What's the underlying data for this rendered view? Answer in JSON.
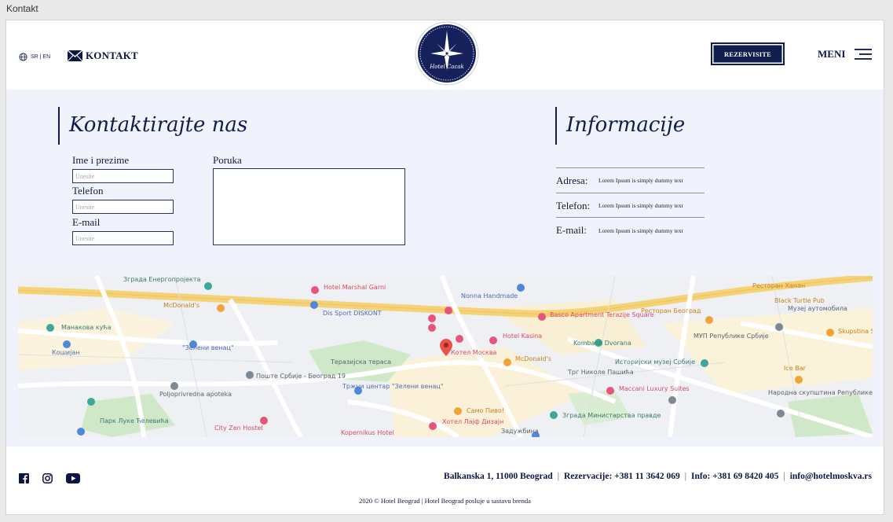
{
  "window_title": "Kontakt",
  "header": {
    "lang_label": "SR | EN",
    "kontakt_label": "KONTAKT",
    "logo_text": "Hotel Cacak",
    "reserve_label": "REZERVISITE",
    "menu_label": "MENI"
  },
  "contact": {
    "heading": "Kontaktirajte nas",
    "name_label": "Ime i prezime",
    "name_placeholder": "Unesite",
    "phone_label": "Telefon",
    "phone_placeholder": "Unesite",
    "email_label": "E-mail",
    "email_placeholder": "Unesite",
    "message_label": "Poruka"
  },
  "info": {
    "heading": "Informacije",
    "rows": [
      {
        "key": "Adresa:",
        "value": "Lorem Ipsum is simply dummy text"
      },
      {
        "key": "Telefon:",
        "value": "Lorem Ipsum is simply dummy text"
      },
      {
        "key": "E-mail:",
        "value": "Lorem Ipsum is simply dummy text"
      }
    ]
  },
  "map": {
    "labels": [
      "Зграда Енергопројекта",
      "Hotel Marshal Garni",
      "Nonna Handmade",
      "Ресторан Ханан",
      "McDonald's",
      "Dis Sport DISKONT",
      "Манакова кућа",
      "Hotel Kasina",
      "Basco Apartment Terazije Square",
      "Ресторан Београд",
      "Музеј аутомобила",
      "Кошијан",
      "\"Зелени венац\"",
      "Котел Москва",
      "Kombank Dvorana",
      "МУП Републике Србије",
      "Теразијска тераса",
      "Поште Србије - Београд 19",
      "McDonald's",
      "Трг Николе Пашића",
      "Историјски музеј Србије",
      "Ice Bar",
      "Poljoprivredna apoteka",
      "Тржни центар \"Зелени венац\"",
      "Maccani Luxury Suites",
      "Народна скупштина Републике Србије",
      "Парк Луке Ћелевића",
      "City Zen Hostel",
      "Само Пиво!",
      "Хотел Лајф Дизајн",
      "Зграда Министарства правде",
      "Kopernikus Hotel",
      "Задужбина",
      "Black Turtle Pub",
      "Skupstina Shop"
    ]
  },
  "footer": {
    "address": "Balkanska 1, 11000 Beograd",
    "reservations": "Rezervacije: +381 11 3642 069",
    "info_phone": "Info: +381 69 8420 405",
    "email": "info@hotelmoskva.rs",
    "copyright": "2020 © Hotel Beograd | Hotel Beograd posluje u sastavu brenda"
  },
  "colors": {
    "navy": "#121d4f",
    "section_bg": "#f0f3fb",
    "map_road_yellow": "#f6d277",
    "map_park_green": "#cfe8c7",
    "map_pin_red": "#e5534b",
    "map_pin_pink": "#e8557c"
  }
}
